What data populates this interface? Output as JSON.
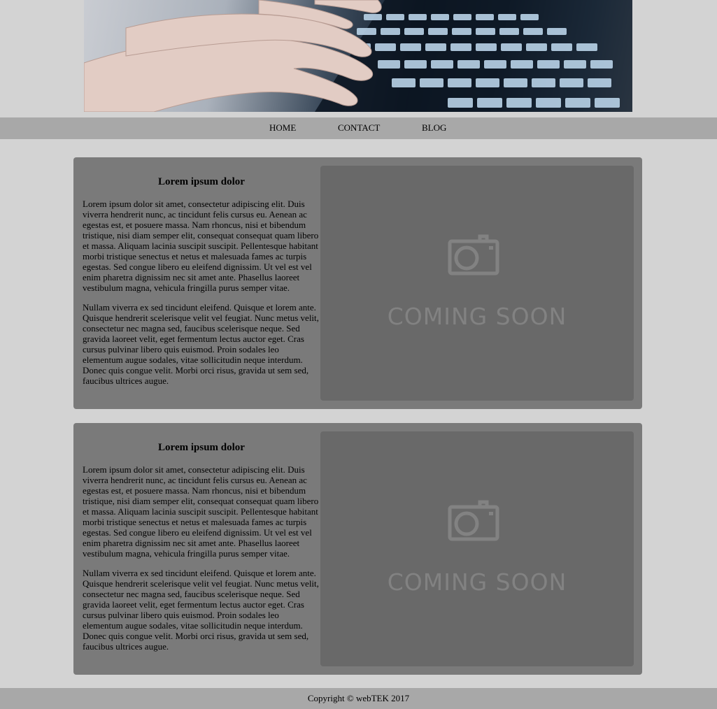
{
  "nav": {
    "items": [
      "HOME",
      "CONTACT",
      "BLOG"
    ]
  },
  "cards": [
    {
      "title": "Lorem ipsum dolor",
      "paragraphs": [
        "Lorem ipsum dolor sit amet, consectetur adipiscing elit. Duis viverra hendrerit nunc, ac tincidunt felis cursus eu. Aenean ac egestas est, et posuere massa. Nam rhoncus, nisi et bibendum tristique, nisi diam semper elit, consequat consequat quam libero et massa. Aliquam lacinia suscipit suscipit. Pellentesque habitant morbi tristique senectus et netus et malesuada fames ac turpis egestas. Sed congue libero eu eleifend dignissim. Ut vel est vel enim pharetra dignissim nec sit amet ante. Phasellus laoreet vestibulum magna, vehicula fringilla purus semper vitae.",
        "Nullam viverra ex sed tincidunt eleifend. Quisque et lorem ante. Quisque hendrerit scelerisque velit vel feugiat. Nunc metus velit, consectetur nec magna sed, faucibus scelerisque neque. Sed gravida laoreet velit, eget fermentum lectus auctor eget. Cras cursus pulvinar libero quis euismod. Proin sodales leo elementum augue sodales, vitae sollicitudin neque interdum. Donec quis congue velit. Morbi orci risus, gravida ut sem sed, faucibus ultrices augue."
      ],
      "image_text": "COMING SOON"
    },
    {
      "title": "Lorem ipsum dolor",
      "paragraphs": [
        "Lorem ipsum dolor sit amet, consectetur adipiscing elit. Duis viverra hendrerit nunc, ac tincidunt felis cursus eu. Aenean ac egestas est, et posuere massa. Nam rhoncus, nisi et bibendum tristique, nisi diam semper elit, consequat consequat quam libero et massa. Aliquam lacinia suscipit suscipit. Pellentesque habitant morbi tristique senectus et netus et malesuada fames ac turpis egestas. Sed congue libero eu eleifend dignissim. Ut vel est vel enim pharetra dignissim nec sit amet ante. Phasellus laoreet vestibulum magna, vehicula fringilla purus semper vitae.",
        "Nullam viverra ex sed tincidunt eleifend. Quisque et lorem ante. Quisque hendrerit scelerisque velit vel feugiat. Nunc metus velit, consectetur nec magna sed, faucibus scelerisque neque. Sed gravida laoreet velit, eget fermentum lectus auctor eget. Cras cursus pulvinar libero quis euismod. Proin sodales leo elementum augue sodales, vitae sollicitudin neque interdum. Donec quis congue velit. Morbi orci risus, gravida ut sem sed, faucibus ultrices augue."
      ],
      "image_text": "COMING SOON"
    }
  ],
  "footer": {
    "text": "Copyright © webTEK 2017"
  },
  "colors": {
    "page_background": "#d3d3d3",
    "bar_background": "#a8a8a8",
    "card_background": "#7a7a7a",
    "placeholder_background": "#696969"
  },
  "icons": {
    "hero": "keyboard-hands-photo",
    "placeholder": "camera-icon"
  }
}
